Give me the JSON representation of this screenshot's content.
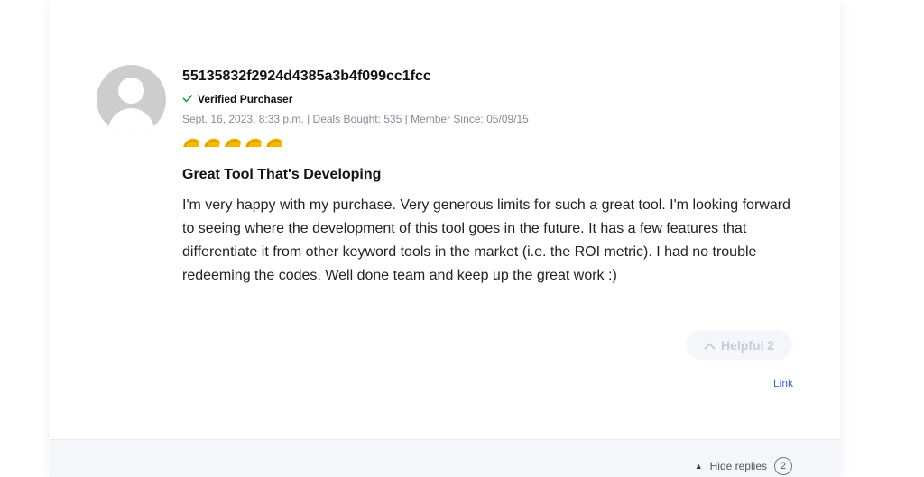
{
  "review": {
    "username": "55135832f2924d4385a3b4f099cc1fcc",
    "verified_label": "Verified Purchaser",
    "meta": "Sept. 16, 2023, 8:33 p.m. | Deals Bought: 535 | Member Since: 05/09/15",
    "rating": 5,
    "rating_max": 5,
    "rating_icon": "taco-icon",
    "title": "Great Tool That's Developing",
    "body": "I'm very happy with my purchase. Very generous limits for such a great tool. I'm looking forward to seeing where the development of this tool goes in the future. It has a few features that differentiate it from other keyword tools in the market (i.e. the ROI metric). I had no trouble redeeming the codes. Well done team and keep up the great work :)",
    "helpful_label": "Helpful 2",
    "link_label": "Link"
  },
  "replies": {
    "toggle_label": "Hide replies",
    "count": "2"
  },
  "colors": {
    "verified_check": "#1aa34a",
    "taco": "#f5b800",
    "link": "#3a63c8",
    "meta": "#8a8a99"
  }
}
